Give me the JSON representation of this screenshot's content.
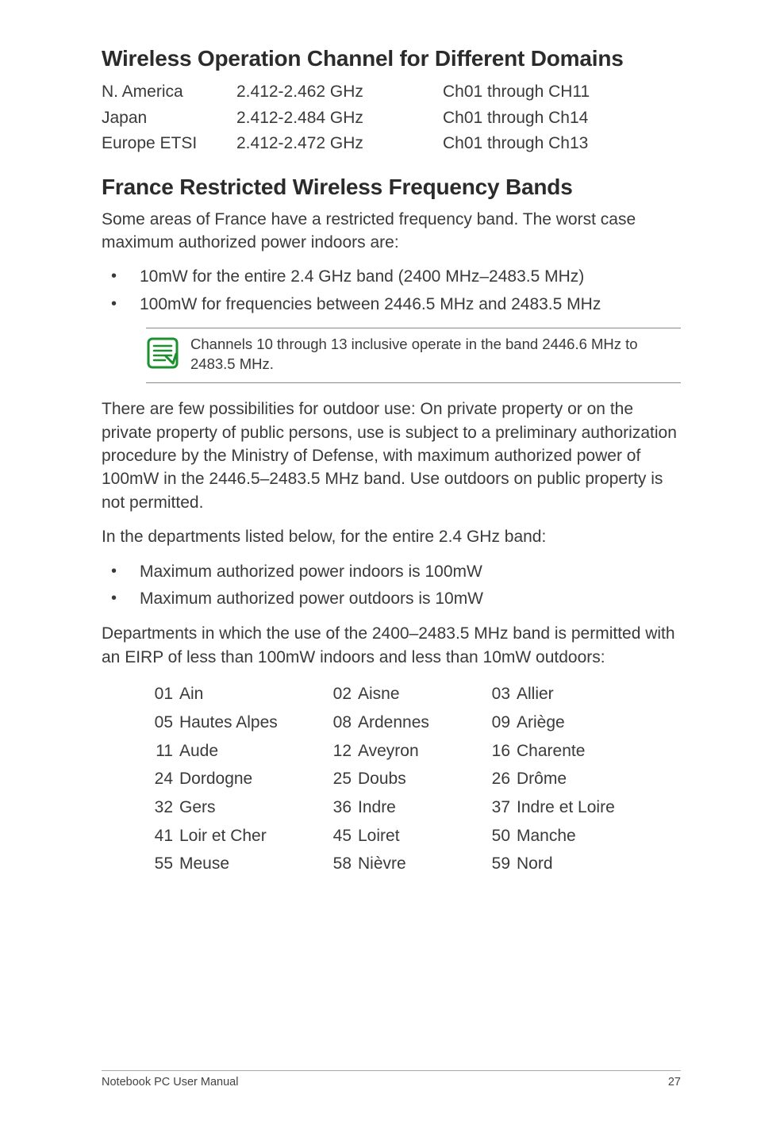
{
  "heading1": "Wireless Operation Channel for Different Domains",
  "channel_table": [
    {
      "region": "N. America",
      "freq": "2.412-2.462 GHz",
      "chan": "Ch01 through CH11"
    },
    {
      "region": "Japan",
      "freq": "2.412-2.484 GHz",
      "chan": "Ch01 through Ch14"
    },
    {
      "region": "Europe ETSI",
      "freq": "2.412-2.472 GHz",
      "chan": "Ch01 through Ch13"
    }
  ],
  "heading2": "France Restricted Wireless Frequency Bands",
  "para1": "Some areas of France have a restricted frequency band. The worst case maximum authorized power indoors are:",
  "bullets1": [
    "10mW for the entire 2.4 GHz band (2400 MHz–2483.5 MHz)",
    "100mW for frequencies between 2446.5 MHz and 2483.5 MHz"
  ],
  "note": "Channels 10 through 13 inclusive operate in the band 2446.6 MHz to 2483.5 MHz.",
  "para2": "There are few possibilities for outdoor use: On private property or on the private property of public persons, use is subject to a preliminary authorization procedure by the Ministry of Defense, with maximum authorized power of 100mW in the 2446.5–2483.5 MHz band. Use outdoors on public property is not permitted.",
  "para3": "In the departments listed below, for the entire 2.4 GHz band:",
  "bullets2": [
    "Maximum authorized power indoors is 100mW",
    "Maximum authorized power outdoors is 10mW"
  ],
  "para4": "Departments in which the use of the 2400–2483.5 MHz band is permitted with an EIRP of less than 100mW indoors and less than 10mW outdoors:",
  "dept_table": [
    [
      {
        "n": "01",
        "t": "Ain"
      },
      {
        "n": "02",
        "t": "Aisne"
      },
      {
        "n": "03",
        "t": "Allier"
      }
    ],
    [
      {
        "n": "05",
        "t": "Hautes Alpes"
      },
      {
        "n": "08",
        "t": "Ardennes"
      },
      {
        "n": "09",
        "t": "Ariège"
      }
    ],
    [
      {
        "n": "11",
        "t": "Aude"
      },
      {
        "n": "12",
        "t": "Aveyron"
      },
      {
        "n": "16",
        "t": "Charente"
      }
    ],
    [
      {
        "n": "24",
        "t": "Dordogne"
      },
      {
        "n": "25",
        "t": "Doubs"
      },
      {
        "n": "26",
        "t": "Drôme"
      }
    ],
    [
      {
        "n": "32",
        "t": "Gers"
      },
      {
        "n": "36",
        "t": "Indre"
      },
      {
        "n": "37",
        "t": "Indre et Loire"
      }
    ],
    [
      {
        "n": "41",
        "t": "Loir et Cher"
      },
      {
        "n": "45",
        "t": "Loiret"
      },
      {
        "n": "50",
        "t": "Manche"
      }
    ],
    [
      {
        "n": "55",
        "t": "Meuse"
      },
      {
        "n": "58",
        "t": "Nièvre"
      },
      {
        "n": "59",
        "t": "Nord"
      }
    ]
  ],
  "footer_left": "Notebook PC User Manual",
  "footer_right": "27"
}
